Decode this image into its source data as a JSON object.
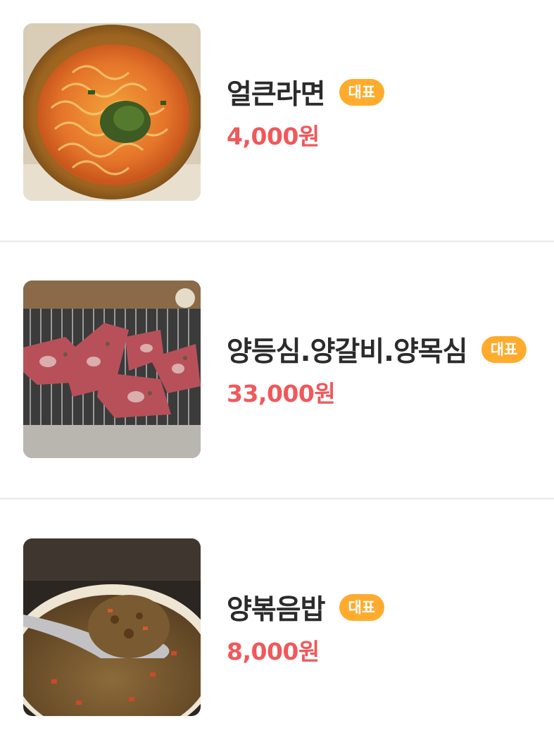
{
  "menu": {
    "items": [
      {
        "name": "얼큰라면",
        "badge": "대표",
        "price": "4,000원",
        "image": "spicy-ramen-photo"
      },
      {
        "name": "양등심.양갈비.양목심",
        "badge": "대표",
        "price": "33,000원",
        "image": "grilled-lamb-photo"
      },
      {
        "name": "양볶음밥",
        "badge": "대표",
        "price": "8,000원",
        "image": "lamb-fried-rice-photo"
      }
    ]
  },
  "colors": {
    "name": "#2b2b2b",
    "price": "#f0585a",
    "badge_bg": "#ffab2e",
    "badge_text": "#ffffff",
    "divider": "#eeeeee"
  }
}
